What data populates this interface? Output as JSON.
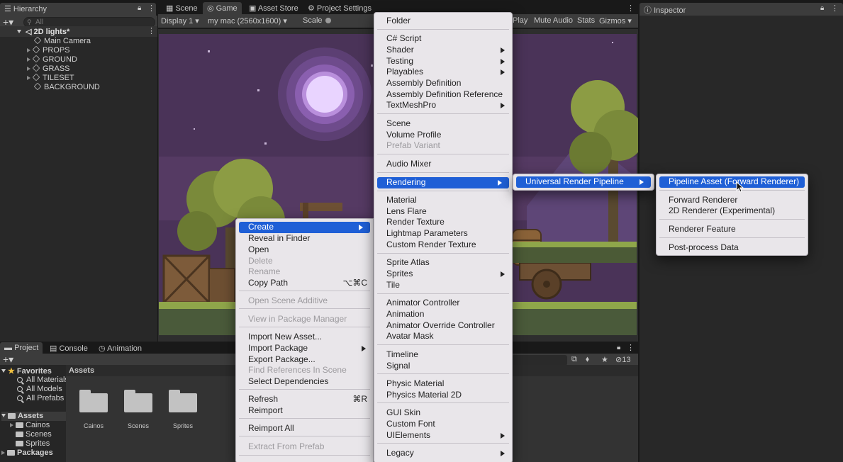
{
  "hierarchy": {
    "tab": "Hierarchy",
    "search_placeholder": "All",
    "scene": "2D lights*",
    "items": [
      "Main Camera",
      "PROPS",
      "GROUND",
      "GRASS",
      "TILESET",
      "BACKGROUND"
    ]
  },
  "center_tabs": [
    "Scene",
    "Game",
    "Asset Store",
    "Project Settings"
  ],
  "game_toolbar": {
    "display": "Display 1",
    "resolution": "my mac (2560x1600)",
    "scale_label": "Scale",
    "play": "Play",
    "mute": "Mute Audio",
    "stats": "Stats",
    "gizmos": "Gizmos"
  },
  "inspector": {
    "tab": "Inspector"
  },
  "bottom_tabs": [
    "Project",
    "Console",
    "Animation"
  ],
  "project": {
    "favorites_label": "Favorites",
    "favorites": [
      "All Materials",
      "All Models",
      "All Prefabs"
    ],
    "assets_label": "Assets",
    "asset_folders": [
      "Cainos",
      "Scenes",
      "Sprites"
    ],
    "packages_label": "Packages",
    "breadcrumb": "Assets",
    "grid": [
      "Cainos",
      "Scenes",
      "Sprites"
    ],
    "hidden_count": "13"
  },
  "context_menu": [
    {
      "label": "Create",
      "state": "selected",
      "submenu": true
    },
    {
      "label": "Reveal in Finder"
    },
    {
      "label": "Open"
    },
    {
      "label": "Delete",
      "state": "disabled"
    },
    {
      "label": "Rename",
      "state": "disabled"
    },
    {
      "label": "Copy Path",
      "shortcut": "⌥⌘C"
    },
    {
      "label": "Open Scene Additive",
      "state": "disabled"
    },
    {
      "label": "View in Package Manager",
      "state": "disabled"
    },
    {
      "label": "Import New Asset..."
    },
    {
      "label": "Import Package",
      "submenu": true
    },
    {
      "label": "Export Package..."
    },
    {
      "label": "Find References In Scene",
      "state": "disabled"
    },
    {
      "label": "Select Dependencies"
    },
    {
      "label": "Refresh",
      "shortcut": "⌘R"
    },
    {
      "label": "Reimport"
    },
    {
      "label": "Reimport All"
    },
    {
      "label": "Extract From Prefab",
      "state": "disabled"
    }
  ],
  "create_menu": [
    {
      "label": "Folder"
    },
    {
      "label": "C# Script"
    },
    {
      "label": "Shader",
      "submenu": true
    },
    {
      "label": "Testing",
      "submenu": true
    },
    {
      "label": "Playables",
      "submenu": true
    },
    {
      "label": "Assembly Definition"
    },
    {
      "label": "Assembly Definition Reference"
    },
    {
      "label": "TextMeshPro",
      "submenu": true
    },
    {
      "label": "Scene"
    },
    {
      "label": "Volume Profile"
    },
    {
      "label": "Prefab Variant",
      "state": "disabled"
    },
    {
      "label": "Audio Mixer"
    },
    {
      "label": "Rendering",
      "state": "selected",
      "submenu": true
    },
    {
      "label": "Material"
    },
    {
      "label": "Lens Flare"
    },
    {
      "label": "Render Texture"
    },
    {
      "label": "Lightmap Parameters"
    },
    {
      "label": "Custom Render Texture"
    },
    {
      "label": "Sprite Atlas"
    },
    {
      "label": "Sprites",
      "submenu": true
    },
    {
      "label": "Tile"
    },
    {
      "label": "Animator Controller"
    },
    {
      "label": "Animation"
    },
    {
      "label": "Animator Override Controller"
    },
    {
      "label": "Avatar Mask"
    },
    {
      "label": "Timeline"
    },
    {
      "label": "Signal"
    },
    {
      "label": "Physic Material"
    },
    {
      "label": "Physics Material 2D"
    },
    {
      "label": "GUI Skin"
    },
    {
      "label": "Custom Font"
    },
    {
      "label": "UIElements",
      "submenu": true
    },
    {
      "label": "Legacy",
      "submenu": true
    }
  ],
  "rendering_menu": [
    {
      "label": "Universal Render Pipeline",
      "state": "selected",
      "submenu": true
    }
  ],
  "urp_menu": [
    {
      "label": "Pipeline Asset (Forward Renderer)",
      "state": "selected"
    },
    {
      "label": "Forward Renderer"
    },
    {
      "label": "2D Renderer (Experimental)"
    },
    {
      "label": "Renderer Feature"
    },
    {
      "label": "Post-process Data"
    }
  ],
  "colors": {
    "menu_bg": "#e9e6ea",
    "highlight": "#1f5fd6",
    "sky": "#4a3358",
    "moon": "#e9d4ff"
  }
}
